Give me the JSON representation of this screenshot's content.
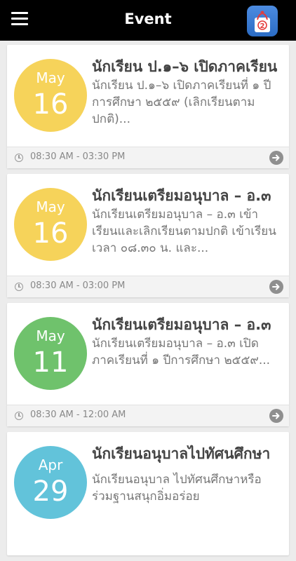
{
  "header": {
    "title": "Event",
    "menu_icon": "hamburger-menu-icon",
    "app_icon": "school-app-icon",
    "app_icon_badge": "2"
  },
  "events": [
    {
      "month": "May",
      "day": "16",
      "color": "#f6d35a",
      "title": "นักเรียน ป.๑–๖ เปิดภาคเรียน",
      "description": "นักเรียน ป.๑–๖ เปิดภาคเรียนที่ ๑ ปีการศึกษา ๒๕๕๙ (เลิกเรียนตามปกติ)...",
      "time": "08:30 AM - 03:30 PM"
    },
    {
      "month": "May",
      "day": "16",
      "color": "#f6d35a",
      "title": "นักเรียนเตรียมอนุบาล – อ.๓",
      "description": "นักเรียนเตรียมอนุบาล – อ.๓ เข้าเรียนและเลิกเรียนตามปกติ เข้าเรียน เวลา ๐๘.๓๐ น. และ...",
      "time": "08:30 AM - 03:00 PM"
    },
    {
      "month": "May",
      "day": "11",
      "color": "#6fc26c",
      "title": "นักเรียนเตรียมอนุบาล – อ.๓",
      "description": "นักเรียนเตรียมอนุบาล – อ.๓ เปิดภาคเรียนที่ ๑ ปีการศึกษา ๒๕๕๙...",
      "time": "08:30 AM - 12:00 AM"
    },
    {
      "month": "Apr",
      "day": "29",
      "color": "#62c3da",
      "title": "นักเรียนอนุบาลไปทัศนศึกษา",
      "description": "นักเรียนอนุบาล ไปทัศนศึกษาหรือ ร่วมฐานสนุกอิ่มอร่อย",
      "time": ""
    }
  ]
}
